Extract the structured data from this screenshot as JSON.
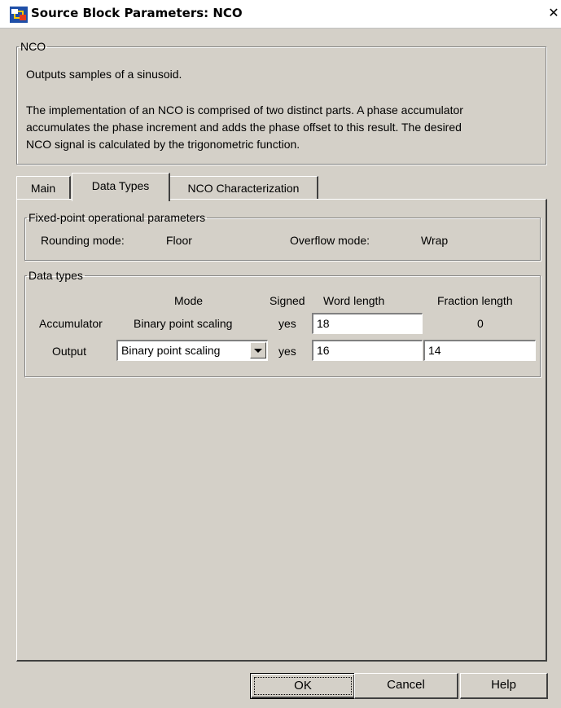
{
  "window": {
    "title": "Source Block Parameters: NCO",
    "close_glyph": "✕"
  },
  "description": {
    "group_label": "NCO",
    "line1": "Outputs samples of a sinusoid.",
    "para2_line1": "The implementation of an NCO is comprised of two distinct parts. A phase accumulator",
    "para2_line2": "accumulates the phase increment and adds the phase offset to this result. The desired",
    "para2_line3": "NCO signal is calculated by the trigonometric function."
  },
  "tabs": [
    {
      "label": "Main",
      "active": false
    },
    {
      "label": "Data Types",
      "active": true
    },
    {
      "label": "NCO Characterization",
      "active": false
    }
  ],
  "fixed_point": {
    "group_label": "Fixed-point operational parameters",
    "rounding_label": "Rounding mode:",
    "rounding_value": "Floor",
    "overflow_label": "Overflow mode:",
    "overflow_value": "Wrap"
  },
  "data_types": {
    "group_label": "Data types",
    "headers": {
      "mode": "Mode",
      "signed": "Signed",
      "word_length": "Word length",
      "fraction_length": "Fraction length"
    },
    "accumulator": {
      "label": "Accumulator",
      "mode": "Binary point scaling",
      "signed": "yes",
      "word_length": "18",
      "fraction_length": "0"
    },
    "output": {
      "label": "Output",
      "mode": "Binary point scaling",
      "signed": "yes",
      "word_length": "16",
      "fraction_length": "14"
    }
  },
  "buttons": {
    "ok": "OK",
    "cancel": "Cancel",
    "help": "Help"
  },
  "colors": {
    "dialog_bg": "#d4d0c8",
    "title_bg": "#ffffff"
  },
  "icons": {
    "title": "simulink-block-icon",
    "close": "close-icon"
  }
}
